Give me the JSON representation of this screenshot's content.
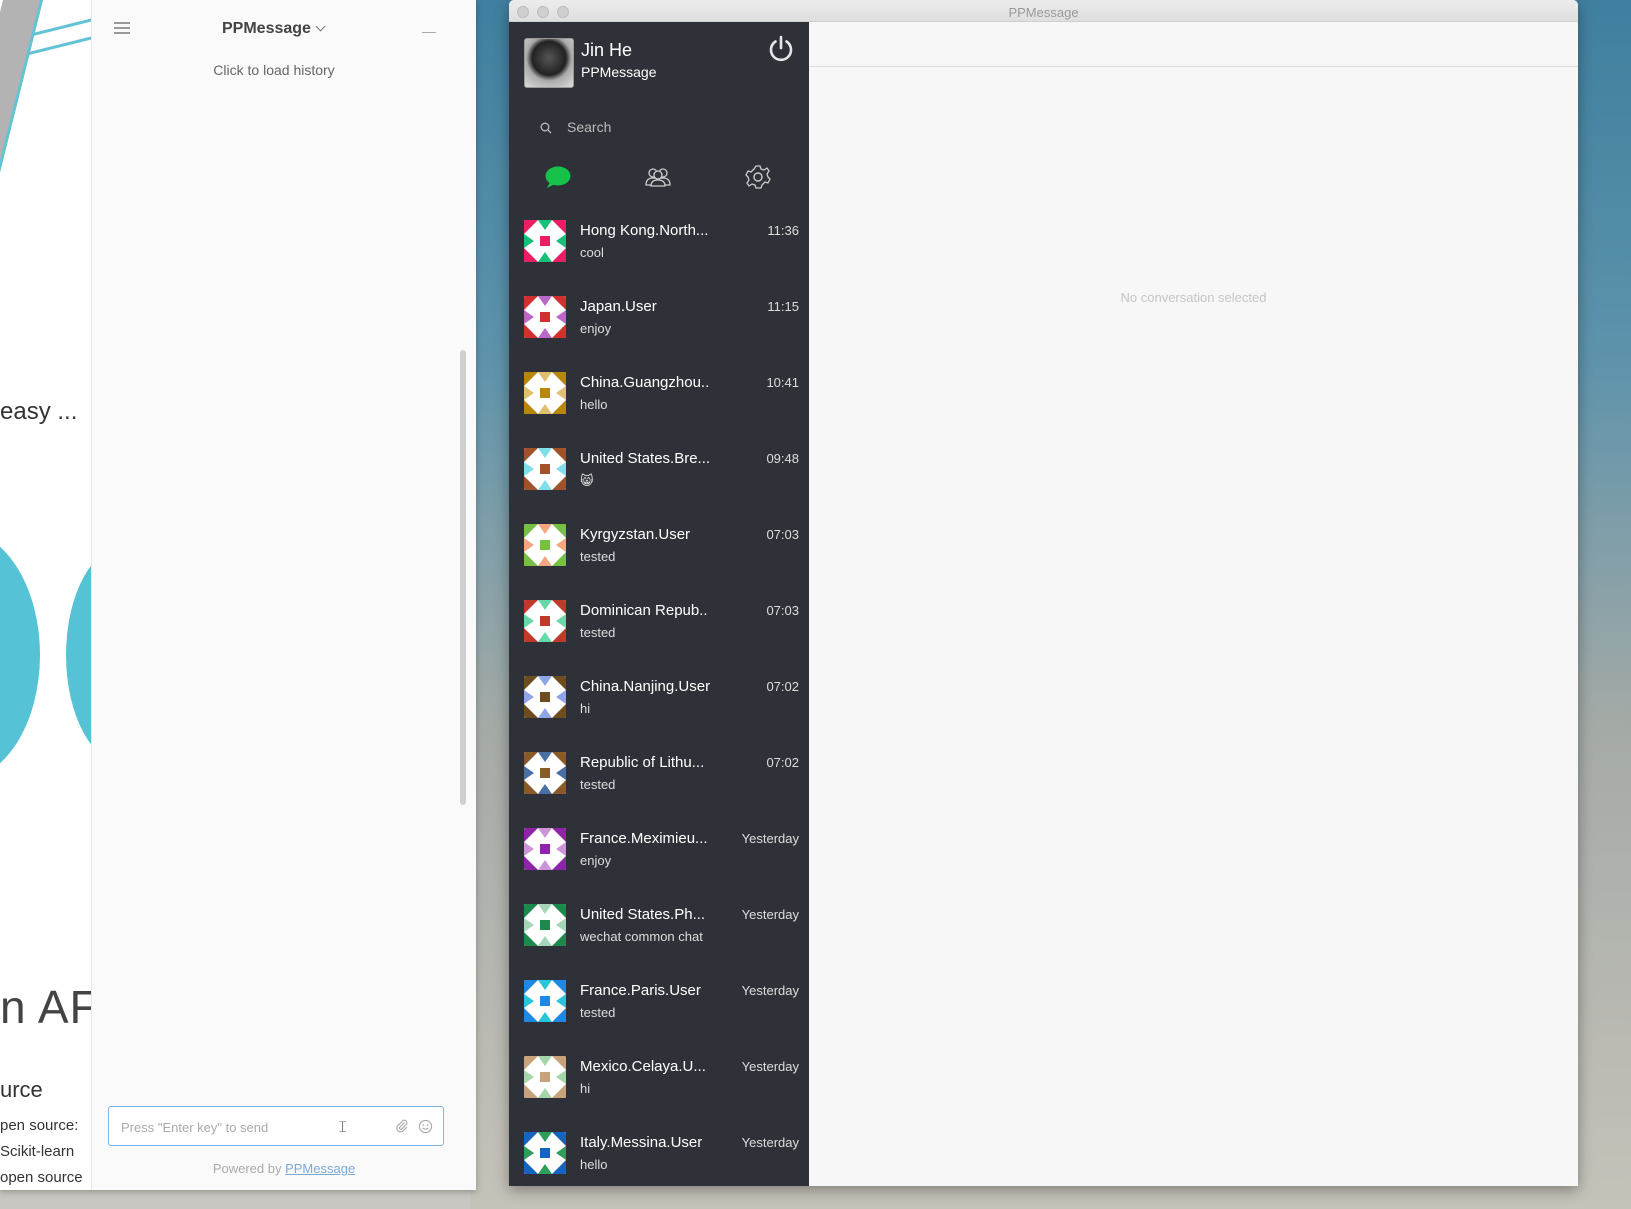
{
  "left_page": {
    "text_easy": "easy ...",
    "text_naf": "n AF",
    "text_urce": "urce",
    "text_open": "pen source:",
    "text_scikit": "Scikit-learn",
    "text_open2": "open source"
  },
  "widget": {
    "title": "PPMessage",
    "load_history": "Click to load history",
    "input_placeholder": "Press \"Enter key\" to send",
    "powered_by": "Powered by",
    "powered_link": "PPMessage"
  },
  "app": {
    "window_title": "PPMessage",
    "profile": {
      "name": "Jin He",
      "org": "PPMessage"
    },
    "search_label": "Search",
    "empty_state": "No conversation selected",
    "accent_color": "#17c24a",
    "sidebar_color": "#2e3238",
    "conversations": [
      {
        "name": "Hong Kong.North...",
        "time": "11:36",
        "message": "cool",
        "colors": [
          "#e91e63",
          "#16c079"
        ]
      },
      {
        "name": "Japan.User",
        "time": "11:15",
        "message": "enjoy",
        "colors": [
          "#d32f2f",
          "#ba68c8"
        ]
      },
      {
        "name": "China.Guangzhou..",
        "time": "10:41",
        "message": "hello",
        "colors": [
          "#b8860b",
          "#e0c070"
        ]
      },
      {
        "name": "United States.Bre...",
        "time": "09:48",
        "message": "😸",
        "colors": [
          "#a0522d",
          "#80deea"
        ]
      },
      {
        "name": "Kyrgyzstan.User",
        "time": "07:03",
        "message": "tested",
        "colors": [
          "#76c043",
          "#f4a582"
        ]
      },
      {
        "name": "Dominican Repub..",
        "time": "07:03",
        "message": "tested",
        "colors": [
          "#c0392b",
          "#66d9a8"
        ]
      },
      {
        "name": "China.Nanjing.User",
        "time": "07:02",
        "message": "hi",
        "colors": [
          "#6d4c1f",
          "#90a4e8"
        ]
      },
      {
        "name": "Republic of Lithu...",
        "time": "07:02",
        "message": "tested",
        "colors": [
          "#8b5a2b",
          "#4a6fa5"
        ]
      },
      {
        "name": "France.Meximieu...",
        "time": "Yesterday",
        "message": "enjoy",
        "colors": [
          "#8e24aa",
          "#ce93d8"
        ]
      },
      {
        "name": "United States.Ph...",
        "time": "Yesterday",
        "message": "wechat common chat",
        "colors": [
          "#1b8a4c",
          "#a5d6b7"
        ]
      },
      {
        "name": "France.Paris.User",
        "time": "Yesterday",
        "message": "tested",
        "colors": [
          "#1e88e5",
          "#26c6da"
        ]
      },
      {
        "name": "Mexico.Celaya.U...",
        "time": "Yesterday",
        "message": "hi",
        "colors": [
          "#c8a27a",
          "#a5d6a7"
        ]
      },
      {
        "name": "Italy.Messina.User",
        "time": "Yesterday",
        "message": "hello",
        "colors": [
          "#1565c0",
          "#2e9e5b"
        ]
      }
    ]
  }
}
